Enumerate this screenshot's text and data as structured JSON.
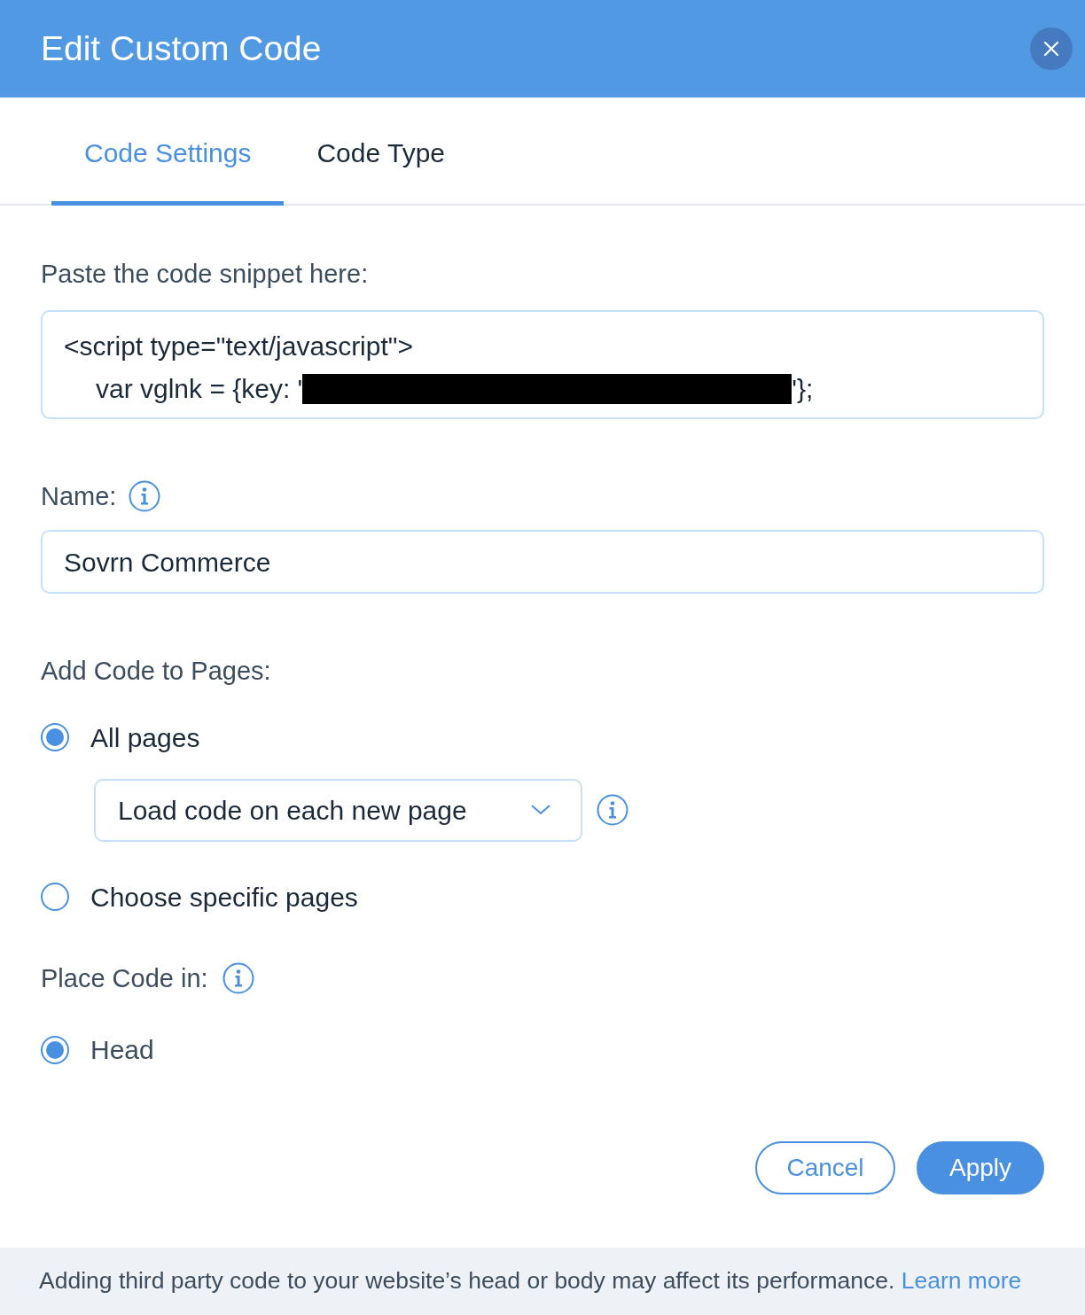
{
  "window": {
    "title": "Edit Custom Code"
  },
  "tabs": [
    {
      "label": "Code Settings",
      "selected": true
    },
    {
      "label": "Code Type",
      "selected": false
    }
  ],
  "snippet": {
    "label": "Paste the code snippet here:",
    "lines": [
      {
        "text": "<script type=\"text/javascript\">",
        "indent": false,
        "redacted": false
      },
      {
        "text": "var vglnk = {key: '",
        "indent": true,
        "redacted": true,
        "after": "'};"
      }
    ]
  },
  "name_field": {
    "label": "Name:",
    "value": "Sovrn Commerce"
  },
  "pages": {
    "label": "Add Code to Pages:",
    "options": [
      {
        "label": "All pages",
        "selected": true,
        "dropdown": "Load code on each new page"
      },
      {
        "label": "Choose specific pages",
        "selected": false
      }
    ]
  },
  "placement": {
    "label": "Place Code in:",
    "options": [
      {
        "label": "Head",
        "selected": true
      }
    ]
  },
  "buttons": [
    {
      "label": "Cancel",
      "kind": "secondary"
    },
    {
      "label": "Apply",
      "kind": "primary"
    }
  ],
  "footer": {
    "text": "Adding third party code to your website’s head or body may affect its performance.",
    "link": "Learn more"
  }
}
